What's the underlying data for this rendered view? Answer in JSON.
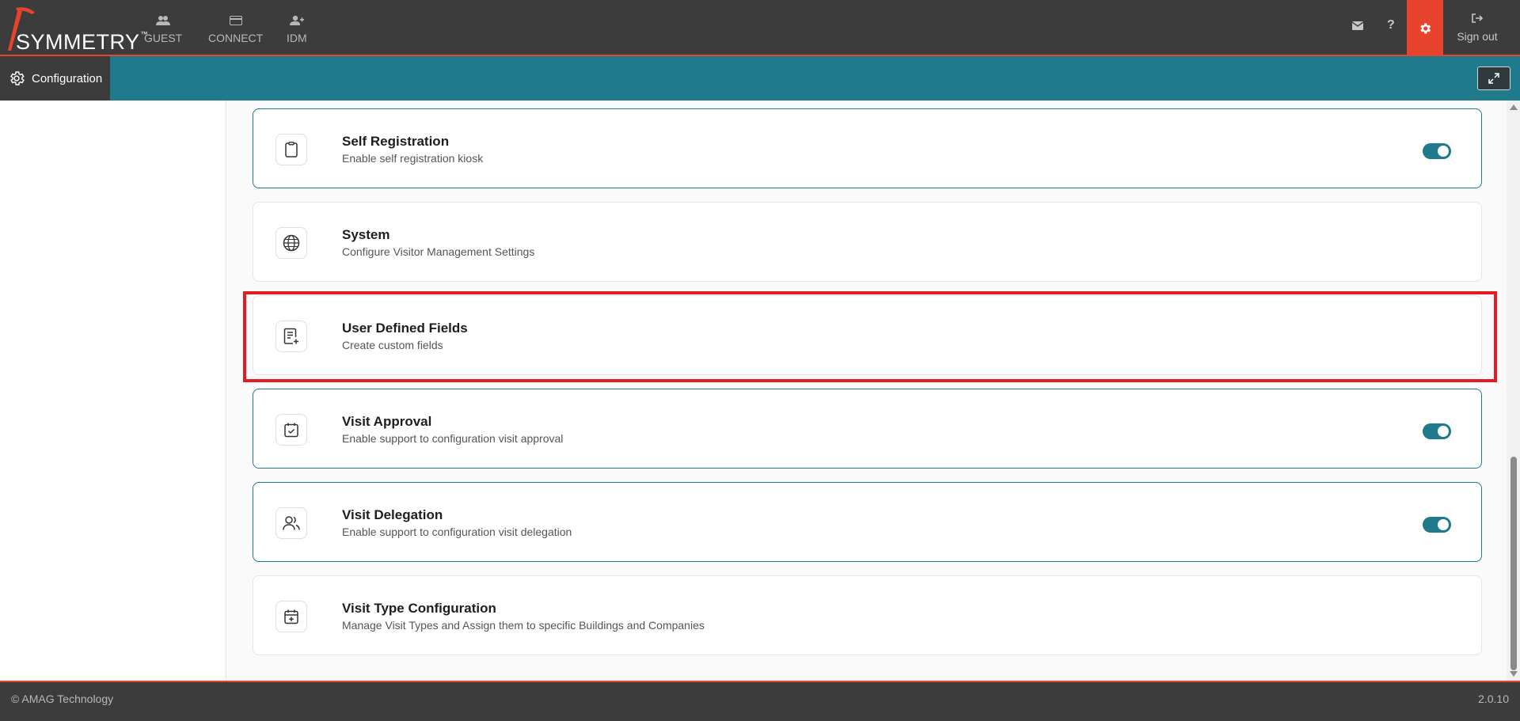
{
  "brand": {
    "name": "SYMMETRY",
    "tm": "™"
  },
  "nav": [
    {
      "label": "GUEST",
      "icon": "users-icon"
    },
    {
      "label": "CONNECT",
      "icon": "card-icon"
    },
    {
      "label": "IDM",
      "icon": "user-add-icon"
    }
  ],
  "topright": {
    "signout_label": "Sign out"
  },
  "subbar": {
    "config_label": "Configuration"
  },
  "cards": [
    {
      "title": "Self Registration",
      "desc": "Enable self registration kiosk",
      "toggle": true,
      "icon": "clipboard-icon"
    },
    {
      "title": "System",
      "desc": "Configure Visitor Management Settings",
      "toggle": false,
      "icon": "globe-icon"
    },
    {
      "title": "User Defined Fields",
      "desc": "Create custom fields",
      "toggle": false,
      "icon": "document-add-icon"
    },
    {
      "title": "Visit Approval",
      "desc": "Enable support to configuration visit approval",
      "toggle": true,
      "icon": "calendar-check-icon"
    },
    {
      "title": "Visit Delegation",
      "desc": "Enable support to configuration visit delegation",
      "toggle": true,
      "icon": "users-outline-icon"
    },
    {
      "title": "Visit Type Configuration",
      "desc": "Manage Visit Types and Assign them to specific Buildings and Companies",
      "toggle": false,
      "icon": "calendar-plus-icon"
    }
  ],
  "footer": {
    "copyright": "© AMAG Technology",
    "version": "2.0.10"
  },
  "colors": {
    "accent": "#e8432d",
    "teal": "#1f7a8c",
    "dark": "#3c3c3c",
    "highlight": "#e21c23"
  }
}
